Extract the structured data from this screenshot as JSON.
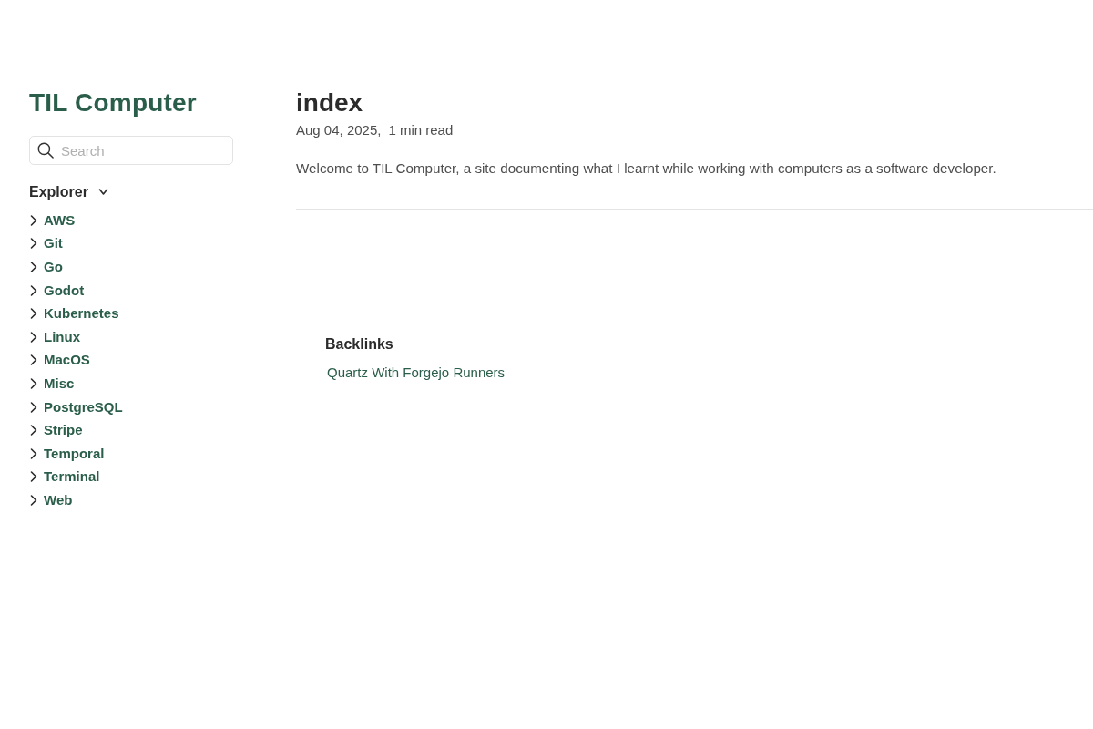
{
  "site_title": "TIL Computer",
  "search": {
    "placeholder": "Search"
  },
  "explorer": {
    "title": "Explorer",
    "expanded": true,
    "items": [
      {
        "label": "AWS",
        "expanded": false
      },
      {
        "label": "Git",
        "expanded": false
      },
      {
        "label": "Go",
        "expanded": false
      },
      {
        "label": "Godot",
        "expanded": false
      },
      {
        "label": "Kubernetes",
        "expanded": false
      },
      {
        "label": "Linux",
        "expanded": false
      },
      {
        "label": "MacOS",
        "expanded": false
      },
      {
        "label": "Misc",
        "expanded": false
      },
      {
        "label": "PostgreSQL",
        "expanded": false
      },
      {
        "label": "Stripe",
        "expanded": false
      },
      {
        "label": "Temporal",
        "expanded": false
      },
      {
        "label": "Terminal",
        "expanded": false
      },
      {
        "label": "Web",
        "expanded": false
      }
    ]
  },
  "article": {
    "title": "index",
    "date": "Aug 04, 2025,",
    "reading_time": "1 min read",
    "body": "Welcome to TIL Computer, a site documenting what I learnt while working with computers as a software developer."
  },
  "backlinks": {
    "title": "Backlinks",
    "items": [
      "Quartz With Forgejo Runners"
    ]
  }
}
